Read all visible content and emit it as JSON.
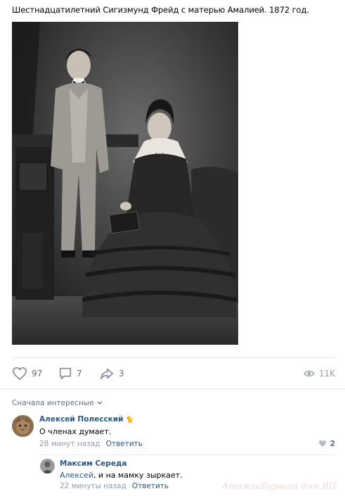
{
  "post": {
    "text": "Шестнадцатилетний Сигизмунд Фрейд с матерью Амалией. 1872 год."
  },
  "actions": {
    "likes": "97",
    "comments": "7",
    "shares": "3",
    "views": "11K",
    "like_icon": "heart-icon",
    "comment_icon": "speech-bubble-icon",
    "share_icon": "share-arrow-icon",
    "views_icon": "eye-icon"
  },
  "comments": {
    "sort_label": "Сначала интересные",
    "items": [
      {
        "author": "Алексей Полесский",
        "author_badge": "🐈",
        "text": "О членах думает.",
        "time": "28 минут назад",
        "reply_label": "Ответить",
        "likes": "2"
      },
      {
        "author": "Максим Середа",
        "reply_to": "Алексей",
        "text": ", и на мамку зыркает.",
        "time": "22 минуты назад",
        "reply_label": "Ответить"
      }
    ]
  },
  "watermark": "АтаманБурнаш для ЯП",
  "colors": {
    "link": "#2a5885",
    "muted": "#939cac",
    "secondary": "#626d7a",
    "divider": "#e7e8ec"
  }
}
